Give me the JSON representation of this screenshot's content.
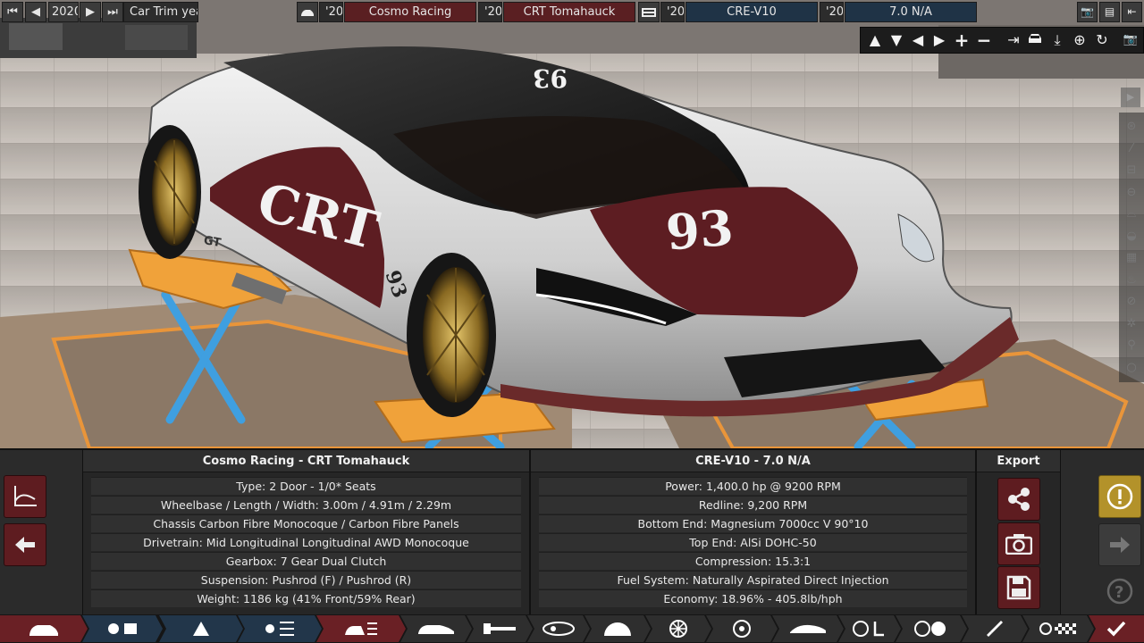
{
  "topbar": {
    "year": "2020",
    "trim_label": "Car Trim year",
    "model_year": "'20",
    "model_name": "Cosmo Racing",
    "trim_year": "'20",
    "trim_name": "CRT Tomahauck",
    "engine_family_year": "'20",
    "engine_family": "CRE-V10",
    "engine_variant_year": "'20",
    "engine_variant": "7.0 N/A"
  },
  "car": {
    "livery_text": "CRT",
    "number": "93",
    "badge": "GT"
  },
  "car_panel": {
    "title": "Cosmo Racing - CRT Tomahauck",
    "rows": [
      "Type: 2 Door - 1/0* Seats",
      "Wheelbase / Length / Width: 3.00m / 4.91m / 2.29m",
      "Chassis Carbon Fibre Monocoque / Carbon Fibre Panels",
      "Drivetrain: Mid Longitudinal Longitudinal AWD Monocoque",
      "Gearbox: 7 Gear Dual Clutch",
      "Suspension: Pushrod (F) / Pushrod (R)",
      "Weight: 1186 kg (41% Front/59% Rear)"
    ]
  },
  "engine_panel": {
    "title": "CRE-V10 - 7.0 N/A",
    "rows": [
      "Power: 1,400.0 hp @ 9200 RPM",
      "Redline:  9,200 RPM",
      "Bottom End: Magnesium 7000cc V 90°10",
      "Top End: AlSi DOHC-50",
      "Compression: 15.3:1",
      "Fuel System: Naturally Aspirated Direct Injection",
      "Economy: 18.96% - 405.8lb/hph"
    ]
  },
  "export_panel": {
    "title": "Export"
  },
  "colors": {
    "accent_red": "#6a2025",
    "accent_blue": "#22364a",
    "warning_gold": "#b3922a"
  }
}
